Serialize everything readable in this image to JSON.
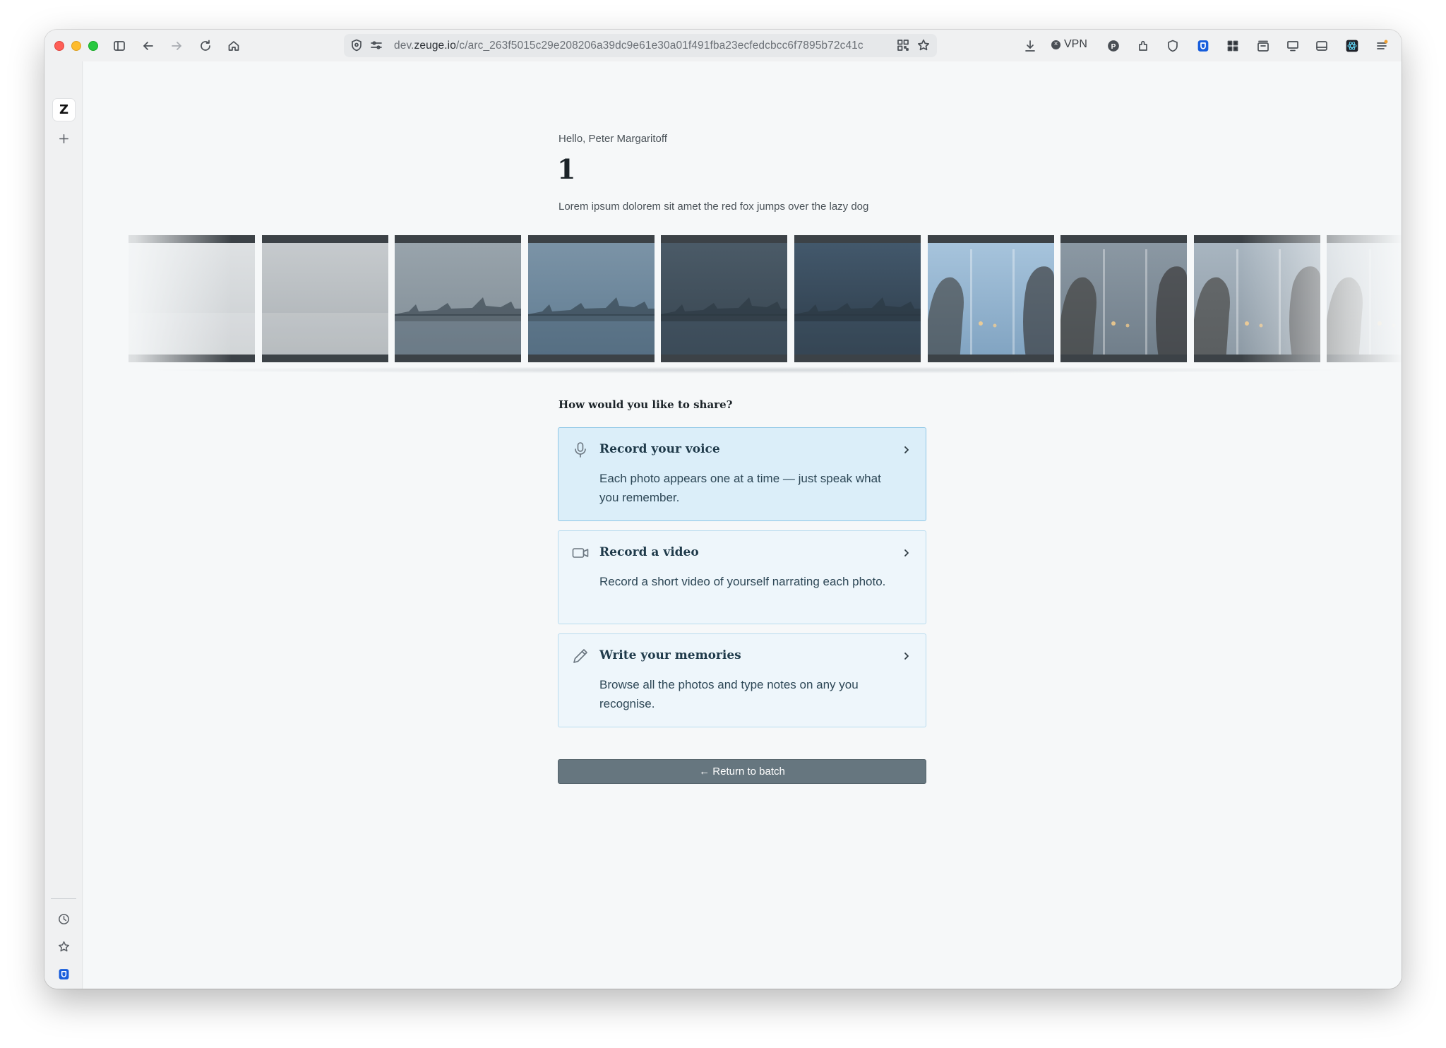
{
  "browser": {
    "url_prefix": "dev.",
    "url_domain": "zeuge.io",
    "url_path": "/c/arc_263f5015c29e208206a39dc9e61e30a01f491fba23ecfedcbcc6f7895b72c41c",
    "vpn_label": "VPN"
  },
  "sidebar": {
    "app_letter": "Z"
  },
  "page": {
    "greeting": "Hello, Peter Margaritoff",
    "number": "1",
    "subtitle": "Lorem ipsum dolorem sit amet the red fox jumps over the lazy dog",
    "share_question": "How would you like to share?",
    "options": [
      {
        "title": "Record your voice",
        "description": "Each photo appears one at a time — just speak what you remember.",
        "icon": "microphone-icon"
      },
      {
        "title": "Record a video",
        "description": "Record a short video of yourself narrating each photo.",
        "icon": "video-camera-icon"
      },
      {
        "title": "Write your memories",
        "description": "Browse all the photos and type notes on any you recognise.",
        "icon": "pencil-icon"
      }
    ],
    "return_button": "← Return to batch"
  },
  "filmstrip": {
    "frames": [
      {
        "kind": "haze",
        "colors": [
          "#dfe2e4",
          "#c9cdd0"
        ]
      },
      {
        "kind": "haze",
        "colors": [
          "#c8cccf",
          "#a9afb3"
        ]
      },
      {
        "kind": "city",
        "colors": [
          "#9aa5ad",
          "#7f8c95"
        ]
      },
      {
        "kind": "city",
        "colors": [
          "#7d95a8",
          "#5e7a90"
        ]
      },
      {
        "kind": "city",
        "colors": [
          "#4c5c69",
          "#36434e"
        ]
      },
      {
        "kind": "city",
        "colors": [
          "#445a6e",
          "#2c3a47"
        ]
      },
      {
        "kind": "people",
        "colors": [
          "#a9c6de",
          "#7fa2c0"
        ]
      },
      {
        "kind": "people",
        "colors": [
          "#8d9aa5",
          "#6f7d89"
        ]
      },
      {
        "kind": "people",
        "colors": [
          "#aab7c2",
          "#8c99a4"
        ]
      },
      {
        "kind": "people",
        "colors": [
          "#c4ccd3",
          "#aab3bb"
        ]
      }
    ]
  },
  "colors": {
    "accent_card_active": "#dbeef9",
    "accent_card": "#eef6fb",
    "button": "#66767f"
  }
}
